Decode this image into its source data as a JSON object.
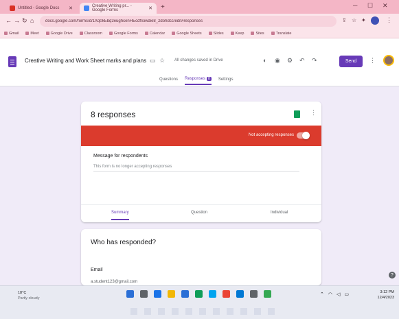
{
  "browser": {
    "tabs": [
      {
        "title": "Untitled - Google Docs"
      },
      {
        "title": "Creative Writing pr... - Google Forms"
      }
    ],
    "new_tab_glyph": "+",
    "url": "docs.google.com/forms/d/1Xq0kEbq3eughcenHEcdfIsiwdie8_2dohdcc/edit#responses",
    "bookmarks": [
      "Gmail",
      "Meet",
      "Google Drive",
      "Classroom",
      "Google Forms",
      "Calendar",
      "Google Sheets",
      "Slides",
      "Keep",
      "Sites",
      "Translate"
    ],
    "icons": {
      "back": "arrow-left-icon",
      "forward": "arrow-right-icon",
      "reload": "reload-icon",
      "share": "share-icon",
      "star": "star-icon",
      "extensions": "puzzle-icon",
      "menu": "kebab-menu-icon"
    }
  },
  "forms": {
    "doc_title": "Creative Writing and Work Sheet marks and plans",
    "save_status": "All changes saved in Drive",
    "send_label": "Send",
    "tabs": [
      {
        "label": "Questions"
      },
      {
        "label": "Responses",
        "badge": "8"
      },
      {
        "label": "Settings"
      }
    ]
  },
  "responses": {
    "count_label": "8 responses",
    "accepting_label": "Not accepting responses",
    "accepting": false,
    "message_title": "Message for respondents",
    "message_placeholder": "This form is no longer accepting responses",
    "view_tabs": [
      {
        "label": "Summary"
      },
      {
        "label": "Question"
      },
      {
        "label": "Individual"
      }
    ],
    "who_title": "Who has responded?",
    "email_label": "Email",
    "first_email": "a.student123@gmail.com"
  },
  "taskbar": {
    "weather_temp": "18°C",
    "weather_desc": "Partly cloudy",
    "time": "3:12 PM",
    "date": "12/4/2023",
    "app_colors": [
      "#2b6fd6",
      "#5f6368",
      "#1a73e8",
      "#f2b705",
      "#2b6fd6",
      "#0f9d58",
      "#00a4ef",
      "#ea4335",
      "#0078d4",
      "#5f6368",
      "#34a853"
    ]
  },
  "colors": {
    "forms_purple": "#673ab7",
    "not_accepting_red": "#db3b2d",
    "forms_bg": "#f0ebf8",
    "sheets_green": "#0f9d58"
  }
}
